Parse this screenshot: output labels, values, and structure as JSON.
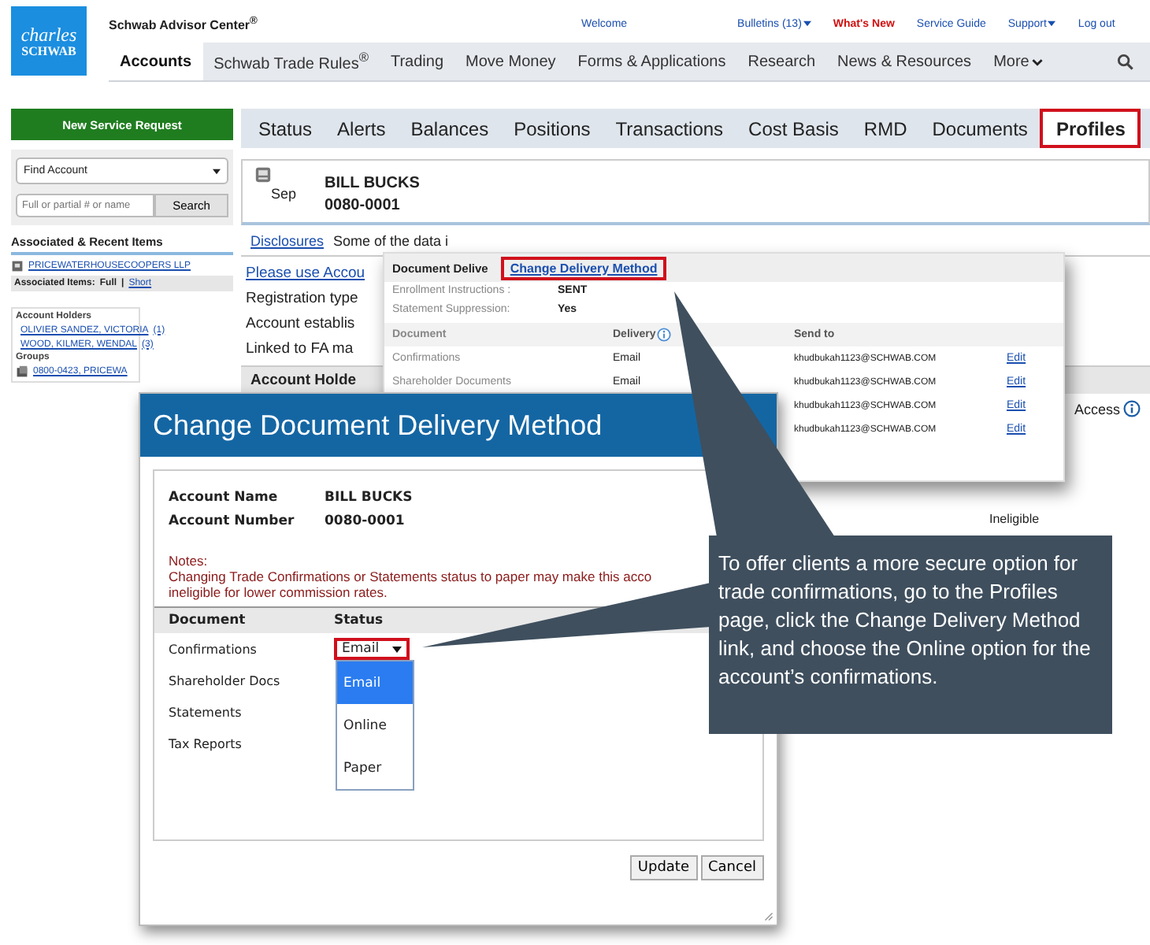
{
  "header": {
    "logo": {
      "line1": "charles",
      "line2": "SCHWAB"
    },
    "title": "Schwab Advisor Center$^{®}$",
    "top_links": [
      {
        "label": "Welcome",
        "kind": "link",
        "caret": false
      },
      {
        "label": "Bulletins (13)",
        "kind": "link",
        "caret": true
      },
      {
        "label": "What's New",
        "kind": "alert",
        "caret": false
      },
      {
        "label": "Service Guide",
        "kind": "link",
        "caret": false
      },
      {
        "label": "Support",
        "kind": "link",
        "caret": true
      },
      {
        "label": "Log out",
        "kind": "link",
        "caret": false
      }
    ],
    "nav": [
      {
        "label": "Accounts",
        "selected": true,
        "caret": false
      },
      {
        "label": "Schwab Trade Rules$^{®}$",
        "selected": false,
        "caret": false
      },
      {
        "label": "Trading",
        "selected": false,
        "caret": false
      },
      {
        "label": "Move Money",
        "selected": false,
        "caret": false
      },
      {
        "label": "Forms & Applications",
        "selected": false,
        "caret": false
      },
      {
        "label": "Research",
        "selected": false,
        "caret": false
      },
      {
        "label": "News & Resources",
        "selected": false,
        "caret": false
      },
      {
        "label": "More",
        "selected": false,
        "caret": true
      }
    ]
  },
  "sidebar": {
    "new_button": "New Service Request",
    "find_select": "Find Account",
    "search": {
      "placeholder": "Full or partial # or name",
      "button": "Search"
    },
    "recent_title": "Associated & Recent Items",
    "recent_items": [
      "PRICEWATERHOUSECOOPERS LLP"
    ],
    "associated_label": "Associated Items:",
    "view_options": [
      {
        "label": "Full",
        "selected": true
      },
      {
        "label": "Short",
        "selected": false
      }
    ],
    "separator": "|",
    "holders_title": "Account Holders",
    "holders": [
      {
        "name": "OLIVIER SANDEZ, VICTORIA",
        "count": "(1)"
      },
      {
        "name": "WOOD, KILMER, WENDAL",
        "count": "(3)"
      }
    ],
    "groups_title": "Groups",
    "groups": [
      "0800-0423, PRICEWA"
    ]
  },
  "account_tabs": [
    {
      "label": "Status",
      "selected": false,
      "highlighted": false
    },
    {
      "label": "Alerts",
      "selected": false,
      "highlighted": false
    },
    {
      "label": "Balances",
      "selected": false,
      "highlighted": false
    },
    {
      "label": "Positions",
      "selected": false,
      "highlighted": false
    },
    {
      "label": "Transactions",
      "selected": false,
      "highlighted": false
    },
    {
      "label": "Cost Basis",
      "selected": false,
      "highlighted": false
    },
    {
      "label": "RMD",
      "selected": false,
      "highlighted": false
    },
    {
      "label": "Documents",
      "selected": false,
      "highlighted": false
    },
    {
      "label": "Profiles",
      "selected": true,
      "highlighted": true
    }
  ],
  "account": {
    "type": "Sep",
    "name": "BILL BUCKS",
    "number": "0080-0001"
  },
  "disclosures": {
    "link": "Disclosures",
    "text": "Some of the data i"
  },
  "info_lines": [
    {
      "text": "Please use Accou",
      "kind": "link"
    },
    {
      "text": "Registration type",
      "kind": "text"
    },
    {
      "text": "Account establis",
      "kind": "text"
    },
    {
      "text": "Linked to FA ma",
      "kind": "text"
    }
  ],
  "holders_heading": "Account Holde",
  "access_label": "Access",
  "eligibility": "Ineligible",
  "delivery_panel": {
    "tab": "Document Delive",
    "link": {
      "label": "Change Delivery Method",
      "highlighted": true
    },
    "fields": [
      {
        "label": "Enrollment Instructions :",
        "value": "SENT"
      },
      {
        "label": "Statement Suppression:",
        "value": "Yes"
      }
    ],
    "columns": [
      "Document",
      "Delivery",
      "Send to"
    ],
    "rows": [
      {
        "document": "Confirmations",
        "delivery": "Email",
        "send_to": "khudbukah1123@SCHWAB.COM",
        "action": "Edit"
      },
      {
        "document": "Shareholder Documents",
        "delivery": "Email",
        "send_to": "khudbukah1123@SCHWAB.COM",
        "action": "Edit"
      },
      {
        "send_to": "khudbukah1123@SCHWAB.COM",
        "action": "Edit"
      },
      {
        "send_to": "khudbukah1123@SCHWAB.COM",
        "action": "Edit"
      }
    ]
  },
  "modal": {
    "title": "Change Document Delivery Method",
    "fields": [
      {
        "label": "Account Name",
        "value": "BILL BUCKS"
      },
      {
        "label": "Account Number",
        "value": "0080-0001"
      }
    ],
    "notes_title": "Notes:",
    "notes_lines": [
      "Changing Trade Confirmations or Statements status to paper may make this acco",
      "ineligible for lower commission rates."
    ],
    "columns": [
      "Document",
      "Status"
    ],
    "rows": [
      {
        "document": "Confirmations",
        "status": "Email",
        "highlighted": true,
        "expanded": true
      },
      {
        "document": "Shareholder Docs"
      },
      {
        "document": "Statements"
      },
      {
        "document": "Tax Reports"
      }
    ],
    "dropdown_options": [
      {
        "label": "Email",
        "selected": true
      },
      {
        "label": "Online",
        "selected": false
      },
      {
        "label": "Paper",
        "selected": false
      }
    ],
    "buttons": [
      "Update",
      "Cancel"
    ]
  },
  "callout": {
    "text": "To offer clients a more secure option for trade confirmations, go to the Profiles page, click the Change Delivery Method link, and choose the Online option for the account’s confirmations."
  }
}
